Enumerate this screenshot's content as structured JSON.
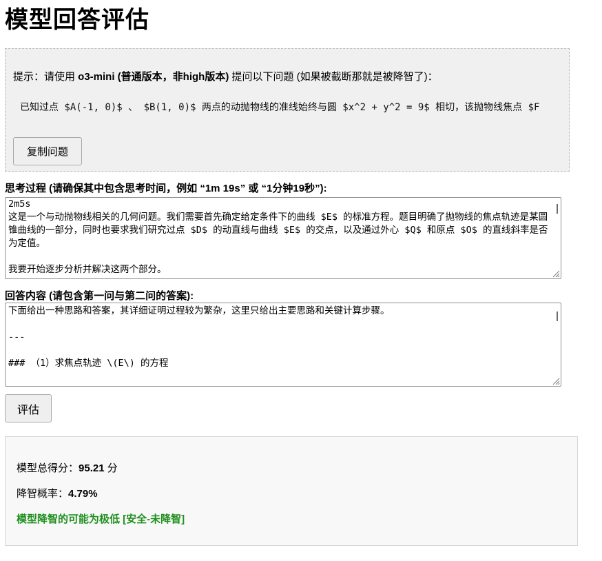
{
  "page": {
    "title": "模型回答评估"
  },
  "prompt_box": {
    "hint_prefix": "提示：请使用 ",
    "hint_model": "o3-mini (普通版本，非high版本)",
    "hint_suffix": " 提问以下问题 (如果被截断那就是被降智了)：",
    "question": "已知过点 $A(-1, 0)$ 、 $B(1, 0)$ 两点的动抛物线的准线始终与圆 $x^2 + y^2 = 9$ 相切，该抛物线焦点 $F",
    "copy_button_label": "复制问题"
  },
  "thinking": {
    "label": "思考过程 (请确保其中包含思考时间，例如 “1m 19s” 或 “1分钟19秒”):",
    "value": "2m5s\n这是一个与动抛物线相关的几何问题。我们需要首先确定给定条件下的曲线 $E$ 的标准方程。题目明确了抛物线的焦点轨迹是某圆锥曲线的一部分，同时也要求我们研究过点 $D$ 的动直线与曲线 $E$ 的交点，以及通过外心 $Q$ 和原点 $O$ 的直线斜率是否为定值。\n\n我要开始逐步分析并解决这两个部分。"
  },
  "answer": {
    "label": "回答内容 (请包含第一问与第二问的答案):",
    "value": "下面给出一种思路和答案，其详细证明过程较为繁杂，这里只给出主要思路和关键计算步骤。\n\n---\n\n### （1）求焦点轨迹 \\(E\\) 的方程\n\n"
  },
  "evaluate_button_label": "评估",
  "result": {
    "score_label": "模型总得分：",
    "score_value": "95.21",
    "score_unit": " 分",
    "prob_label": "降智概率：",
    "prob_value": "4.79%",
    "verdict": "模型降智的可能为极低 [安全-未降智]",
    "verdict_color": "#1f8f1f"
  }
}
